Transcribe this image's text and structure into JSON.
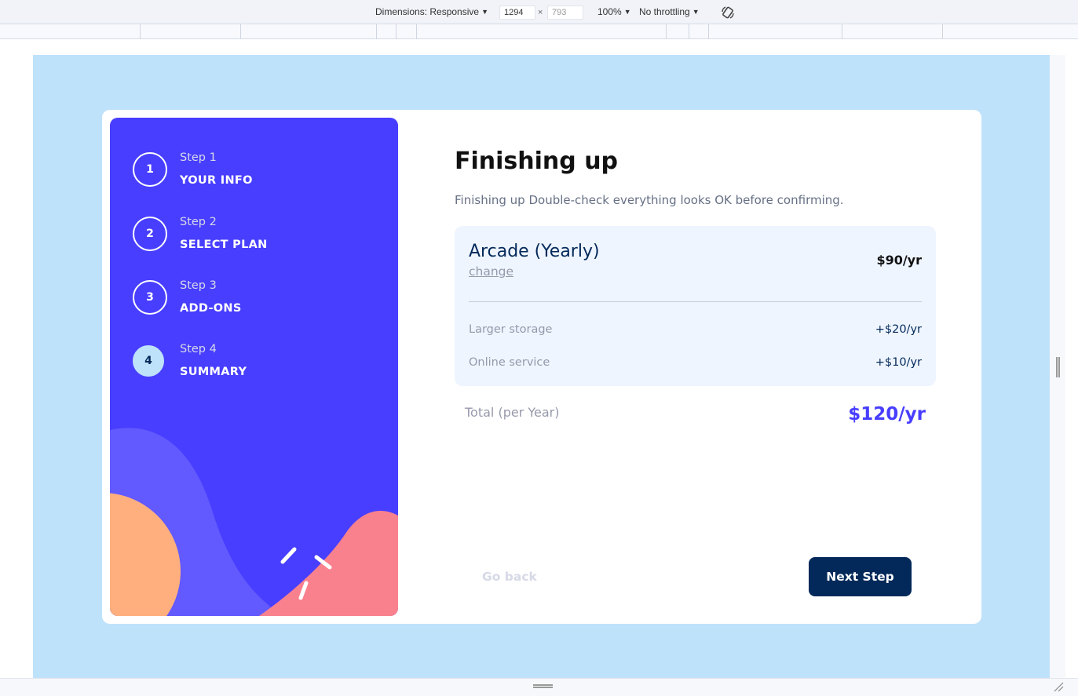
{
  "devtools": {
    "dimensions_label": "Dimensions: Responsive",
    "width": "1294",
    "height": "793",
    "times": "×",
    "zoom": "100%",
    "throttling": "No throttling"
  },
  "sidebar": {
    "steps": [
      {
        "number": "1",
        "label": "Step 1",
        "title": "YOUR INFO",
        "active": false
      },
      {
        "number": "2",
        "label": "Step 2",
        "title": "SELECT PLAN",
        "active": false
      },
      {
        "number": "3",
        "label": "Step 3",
        "title": "ADD-ONS",
        "active": false
      },
      {
        "number": "4",
        "label": "Step 4",
        "title": "SUMMARY",
        "active": true
      }
    ]
  },
  "main": {
    "title": "Finishing up",
    "subtitle": "Finishing up Double-check everything looks OK before confirming.",
    "plan": {
      "name": "Arcade (Yearly)",
      "change_label": "change",
      "price": "$90/yr"
    },
    "addons": [
      {
        "name": "Larger storage",
        "price": "+$20/yr"
      },
      {
        "name": "Online service",
        "price": "+$10/yr"
      }
    ],
    "total": {
      "label": "Total (per Year)",
      "value": "$120/yr"
    },
    "buttons": {
      "back": "Go back",
      "next": "Next Step"
    }
  },
  "colors": {
    "sidebar_bg": "#483eff",
    "active_step_bg": "#bfe2fb",
    "next_button_bg": "#02295a",
    "total_value": "#483eff",
    "page_bg": "#bfe2fb"
  }
}
